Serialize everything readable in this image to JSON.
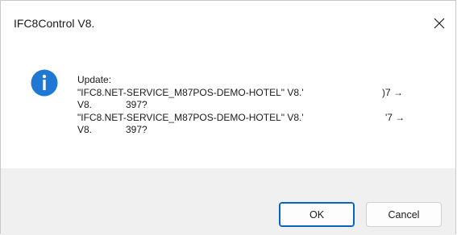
{
  "window": {
    "title": "IFC8Control V8."
  },
  "message": {
    "icon": "info-icon",
    "heading": "Update:",
    "lines": [
      {
        "a": "\"IFC8.NET-SERVICE_M87POS-DEMO-HOTEL\" V8.'",
        "b": ")7 →"
      },
      {
        "a": "V8.",
        "b": "397?"
      },
      {
        "a": "\"IFC8.NET-SERVICE_M87POS-DEMO-HOTEL\" V8.'",
        "b": "'7 →"
      },
      {
        "a": "V8.",
        "b": "397?"
      }
    ]
  },
  "buttons": {
    "ok": "OK",
    "cancel": "Cancel"
  },
  "colors": {
    "accent": "#0067c0",
    "info_icon": "#1e78d4",
    "footer": "#f0f0f0"
  }
}
